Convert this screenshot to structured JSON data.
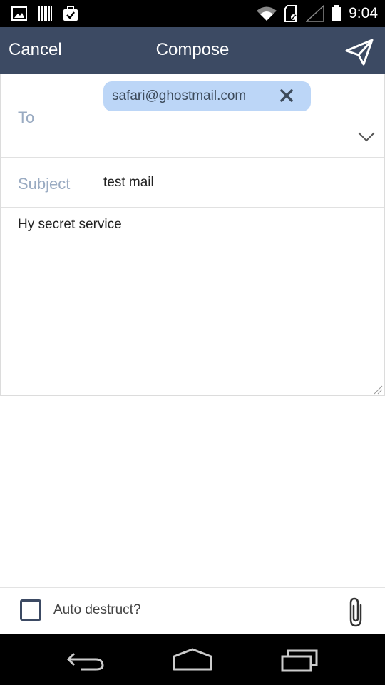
{
  "status_bar": {
    "time": "9:04",
    "icons_left": [
      "picture-icon",
      "barcode-icon",
      "briefcase-check-icon"
    ],
    "icons_right": [
      "wifi-icon",
      "sd-card-icon",
      "signal-icon",
      "battery-icon"
    ]
  },
  "app_bar": {
    "cancel_label": "Cancel",
    "title": "Compose",
    "send_icon": "send-icon",
    "color": "#3c4a63"
  },
  "compose": {
    "to_label": "To",
    "recipients": [
      {
        "address": "safari@ghostmail.com",
        "remove_icon": "close-icon"
      }
    ],
    "expand_icon": "chevron-down-icon",
    "subject_label": "Subject",
    "subject_value": "test mail",
    "body_text": "Hy secret service",
    "chip_color": "#bcd6f7",
    "label_color": "#9aabc2"
  },
  "footer": {
    "auto_destruct_label": "Auto destruct?",
    "auto_destruct_checked": false,
    "attach_icon": "paperclip-icon"
  },
  "nav_bar": {
    "buttons": [
      "back-icon",
      "home-icon",
      "recent-apps-icon"
    ]
  }
}
